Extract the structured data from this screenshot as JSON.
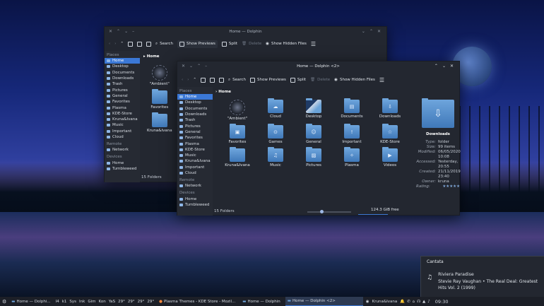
{
  "desktop": {
    "colors": {
      "accent": "#3b78d6",
      "window_bg": "#232730"
    }
  },
  "back_window": {
    "title": "Home — Dolphin",
    "toolbar": {
      "search": "Search",
      "show_previews": "Show Previews",
      "split": "Split",
      "delete": "Delete",
      "show_hidden": "Show Hidden Files"
    },
    "sidebar": {
      "places_label": "Places",
      "places": [
        "Home",
        "Desktop",
        "Documents",
        "Downloads",
        "Trash",
        "Pictures",
        "General",
        "Favorites",
        "Plasma",
        "KDE-Store",
        "Kruna&Ivana",
        "Music",
        "Important",
        "Cloud"
      ],
      "remote_label": "Remote",
      "remote": [
        "Network"
      ],
      "devices_label": "Devices",
      "devices": [
        "Home",
        "Tumbleweed"
      ]
    },
    "breadcrumb": "Home",
    "items": [
      "\"Ambient\"",
      "Favorites",
      "Kruna&Ivana"
    ],
    "status": "15 Folders"
  },
  "front_window": {
    "title": "Home — Dolphin <2>",
    "toolbar": {
      "search": "Search",
      "show_previews": "Show Previews",
      "split": "Split",
      "delete": "Delete",
      "show_hidden": "Show Hidden Files"
    },
    "sidebar": {
      "places_label": "Places",
      "places": [
        "Home",
        "Desktop",
        "Documents",
        "Downloads",
        "Trash",
        "Pictures",
        "General",
        "Favorites",
        "Plasma",
        "KDE-Store",
        "Music",
        "Kruna&Ivana",
        "Important",
        "Cloud"
      ],
      "remote_label": "Remote",
      "remote": [
        "Network"
      ],
      "devices_label": "Devices",
      "devices": [
        "Home",
        "Tumbleweed"
      ]
    },
    "breadcrumb": "Home",
    "items": [
      {
        "label": "\"Ambient\"",
        "icon": "ambient"
      },
      {
        "label": "Cloud",
        "icon": "cloud-icon"
      },
      {
        "label": "Desktop",
        "icon": "desktop-icon"
      },
      {
        "label": "Documents",
        "icon": "document-icon"
      },
      {
        "label": "Downloads",
        "icon": "download-icon"
      },
      {
        "label": "Favorites",
        "icon": "star-folder-icon"
      },
      {
        "label": "Games",
        "icon": "gamepad-icon"
      },
      {
        "label": "General",
        "icon": "people-icon"
      },
      {
        "label": "Important",
        "icon": "exclamation-icon"
      },
      {
        "label": "KDE-Store",
        "icon": "star-icon"
      },
      {
        "label": "Kruna&Ivana",
        "icon": "folder-icon"
      },
      {
        "label": "Music",
        "icon": "music-icon"
      },
      {
        "label": "Pictures",
        "icon": "picture-icon"
      },
      {
        "label": "Plasma",
        "icon": "plasma-icon"
      },
      {
        "label": "Videos",
        "icon": "video-icon"
      }
    ],
    "status": "15 Folders",
    "free_space": "124.3 GiB free",
    "free_space_fraction": 0.6,
    "info_panel": {
      "name": "Downloads",
      "rows": [
        {
          "k": "Type:",
          "v": "folder"
        },
        {
          "k": "Size:",
          "v": "99 items"
        },
        {
          "k": "Modified:",
          "v": "06/05/2020 10:08"
        },
        {
          "k": "Accessed:",
          "v": "Yesterday, 20:55"
        },
        {
          "k": "Created:",
          "v": "21/11/2019 23:40"
        },
        {
          "k": "Owner:",
          "v": "kruna"
        },
        {
          "k": "Rating:",
          "v": ""
        }
      ],
      "rating_stars": 5
    }
  },
  "notification": {
    "app": "Cantata",
    "title": "Riviera Paradise",
    "body": "Stevie Ray Vaughan • The Real Deal: Greatest Hits Vol. 2 (1999)"
  },
  "taskbar": {
    "task_home": "Home — Dolphi...",
    "pager": [
      "I4",
      "k1"
    ],
    "tray_labels": [
      "Sys",
      "Ink",
      "Gim",
      "Kon",
      "YaS"
    ],
    "temps": [
      "29°",
      "29°",
      "29°",
      "29°"
    ],
    "task_browser": "Plasma Themes - KDE Store - Mozil...",
    "task_dolphin1": "Home — Dolphin",
    "task_dolphin2": "Home — Dolphin <2>",
    "user": "Kruna&Ivana",
    "clock": "09:30"
  }
}
